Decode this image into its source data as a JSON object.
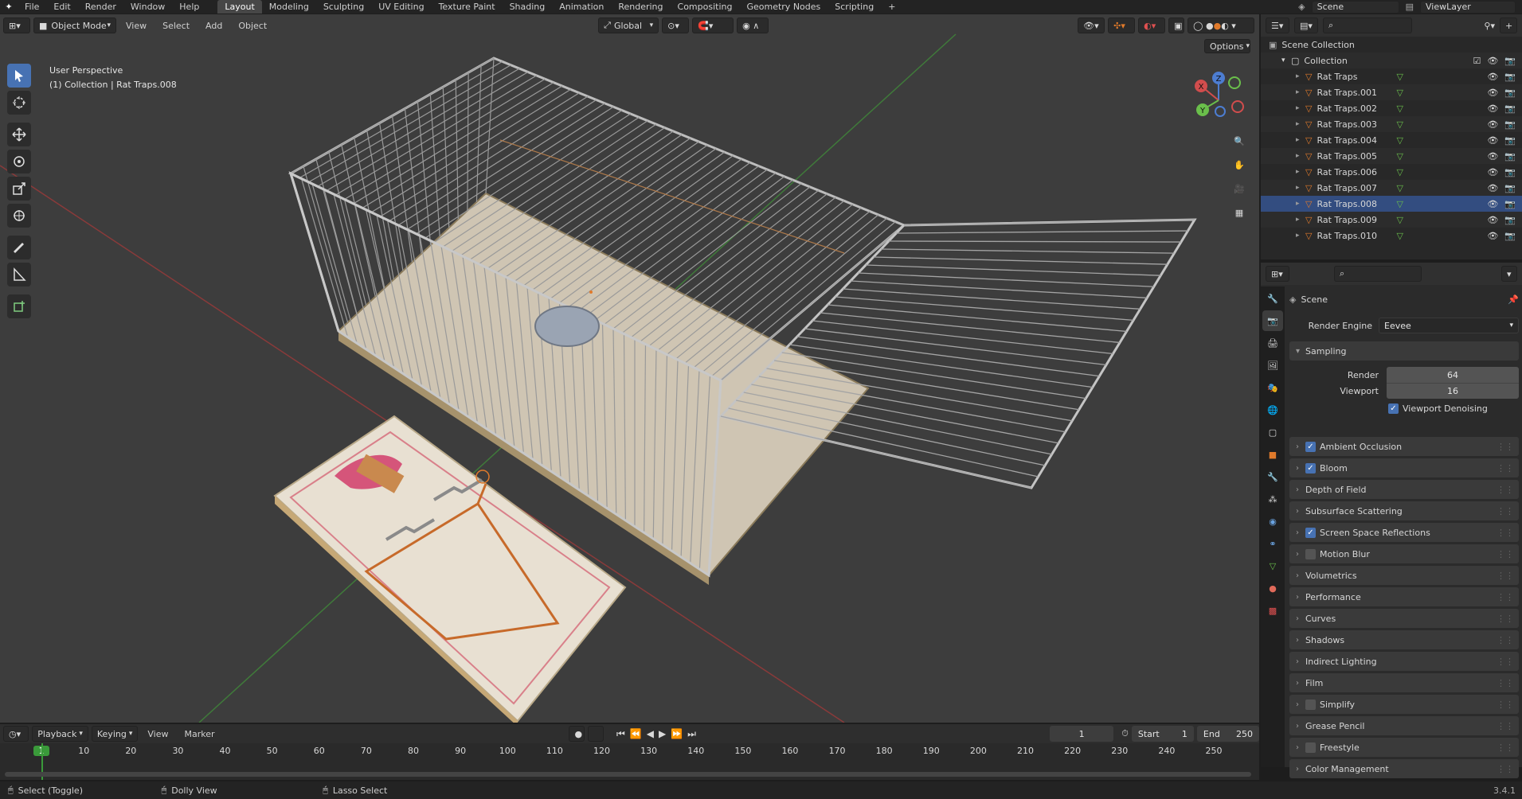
{
  "topbar": {
    "menus": [
      "File",
      "Edit",
      "Render",
      "Window",
      "Help"
    ],
    "tabs": [
      "Layout",
      "Modeling",
      "Sculpting",
      "UV Editing",
      "Texture Paint",
      "Shading",
      "Animation",
      "Rendering",
      "Compositing",
      "Geometry Nodes",
      "Scripting"
    ],
    "active_tab": "Layout",
    "scene": "Scene",
    "view_layer": "ViewLayer"
  },
  "viewport": {
    "mode": "Object Mode",
    "menus": [
      "View",
      "Select",
      "Add",
      "Object"
    ],
    "transform": "Global",
    "options": "Options",
    "overlay_title": "User Perspective",
    "overlay_sub": "(1) Collection | Rat Traps.008",
    "gizmo": {
      "x": "X",
      "y": "Y",
      "z": "Z"
    }
  },
  "outliner": {
    "root": "Scene Collection",
    "collection": "Collection",
    "items": [
      "Rat Traps",
      "Rat Traps.001",
      "Rat Traps.002",
      "Rat Traps.003",
      "Rat Traps.004",
      "Rat Traps.005",
      "Rat Traps.006",
      "Rat Traps.007",
      "Rat Traps.008",
      "Rat Traps.009",
      "Rat Traps.010"
    ],
    "selected": "Rat Traps.008"
  },
  "properties": {
    "context": "Scene",
    "render_engine_label": "Render Engine",
    "render_engine": "Eevee",
    "sampling": "Sampling",
    "render_label": "Render",
    "render_value": "64",
    "viewport_label": "Viewport",
    "viewport_value": "16",
    "denoise": "Viewport Denoising",
    "panels": [
      {
        "label": "Ambient Occlusion",
        "check": true
      },
      {
        "label": "Bloom",
        "check": true
      },
      {
        "label": "Depth of Field",
        "check": null
      },
      {
        "label": "Subsurface Scattering",
        "check": null
      },
      {
        "label": "Screen Space Reflections",
        "check": true
      },
      {
        "label": "Motion Blur",
        "check": false
      },
      {
        "label": "Volumetrics",
        "check": null
      },
      {
        "label": "Performance",
        "check": null
      },
      {
        "label": "Curves",
        "check": null
      },
      {
        "label": "Shadows",
        "check": null
      },
      {
        "label": "Indirect Lighting",
        "check": null
      },
      {
        "label": "Film",
        "check": null
      },
      {
        "label": "Simplify",
        "check": false
      },
      {
        "label": "Grease Pencil",
        "check": null
      },
      {
        "label": "Freestyle",
        "check": false
      },
      {
        "label": "Color Management",
        "check": null
      }
    ]
  },
  "timeline": {
    "menus": [
      "Playback",
      "Keying",
      "View",
      "Marker"
    ],
    "current_frame": "1",
    "start_label": "Start",
    "start": "1",
    "end_label": "End",
    "end": "250",
    "ticks": [
      "1",
      "10",
      "20",
      "30",
      "40",
      "50",
      "60",
      "70",
      "80",
      "90",
      "100",
      "110",
      "120",
      "130",
      "140",
      "150",
      "160",
      "170",
      "180",
      "190",
      "200",
      "210",
      "220",
      "230",
      "240",
      "250"
    ]
  },
  "status": {
    "select": "Select (Toggle)",
    "dolly": "Dolly View",
    "lasso": "Lasso Select",
    "version": "3.4.1"
  },
  "colors": {
    "accent": "#4772b3",
    "orange": "#e07a2b",
    "green_frame": "#3a9a3a"
  }
}
